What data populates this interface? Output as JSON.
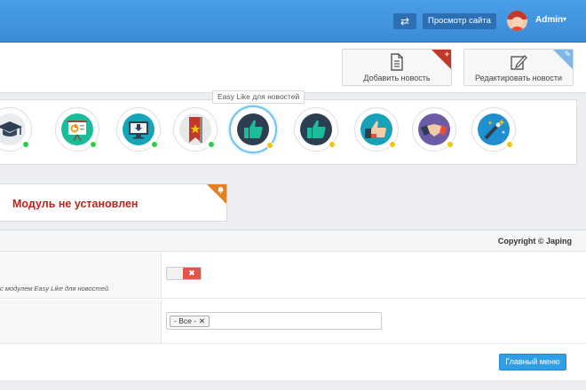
{
  "topbar": {
    "swap_icon": "⇄",
    "view_site_label": "Просмотр сайта",
    "admin_name": "Admin",
    "caret": "▾"
  },
  "actions": {
    "add_news_label": "Добавить новость",
    "edit_news_label": "Редактировать новости",
    "add_corner_glyph": "+",
    "edit_corner_glyph": "✎"
  },
  "modules": {
    "tooltip": "Easy Like для новостей",
    "items": [
      {
        "icon": "graduation-cap-icon",
        "status": "green",
        "bg": "#e9ecef"
      },
      {
        "icon": "presentation-chart-icon",
        "status": "green",
        "bg": "#1abc9c"
      },
      {
        "icon": "download-monitor-icon",
        "status": "green",
        "bg": "#16a5b8"
      },
      {
        "icon": "bookmark-star-icon",
        "status": "green",
        "bg": "#e8e8e8"
      },
      {
        "icon": "thumbs-up-icon",
        "status": "yellow",
        "bg": "#2c3e50",
        "selected": true
      },
      {
        "icon": "thumbs-up-icon",
        "status": "yellow",
        "bg": "#2c3e50"
      },
      {
        "icon": "hand-thumbs-up-icon",
        "status": "yellow",
        "bg": "#17a2b8"
      },
      {
        "icon": "handshake-icon",
        "status": "yellow",
        "bg": "#6c5ca8"
      },
      {
        "icon": "magic-wand-icon",
        "status": "yellow",
        "bg": "#1f8fd0"
      }
    ]
  },
  "alert": {
    "text": "Модуль не установлен",
    "corner_icon": "bell-icon"
  },
  "settings": {
    "copyright": "Copyright © Japing",
    "hint": "с модулем Easy Like для новостей.",
    "toggle_off_glyph": "✖",
    "select_tag": "- Все -",
    "select_tag_remove": "✕"
  },
  "footer": {
    "main_menu_label": "Главный меню"
  }
}
